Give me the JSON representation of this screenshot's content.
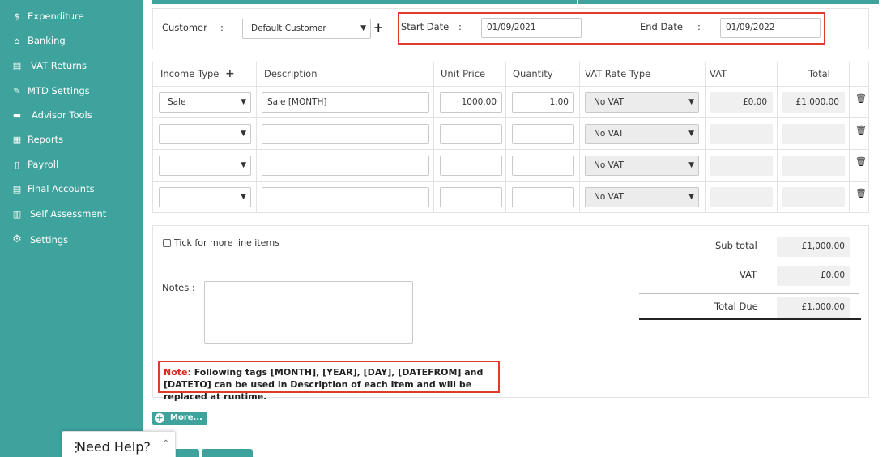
{
  "sidebar": {
    "items": [
      {
        "label": "Expenditure",
        "icon": "money-bag-icon",
        "glyph": "$"
      },
      {
        "label": "Banking",
        "icon": "bank-icon",
        "glyph": "⌂"
      },
      {
        "label": "VAT Returns",
        "icon": "vat-icon",
        "glyph": "▤"
      },
      {
        "label": "MTD Settings",
        "icon": "wrench-icon",
        "glyph": "✎"
      },
      {
        "label": "Advisor Tools",
        "icon": "briefcase-icon",
        "glyph": "▬"
      },
      {
        "label": "Reports",
        "icon": "reports-icon",
        "glyph": "▦"
      },
      {
        "label": "Payroll",
        "icon": "payroll-icon",
        "glyph": "▯"
      },
      {
        "label": "Final Accounts",
        "icon": "final-accounts-icon",
        "glyph": "▤"
      },
      {
        "label": "Self Assessment",
        "icon": "self-assessment-icon",
        "glyph": "▥"
      },
      {
        "label": "Settings",
        "icon": "gear-icon",
        "glyph": "⚙"
      }
    ]
  },
  "header_form": {
    "customer_label": "Customer",
    "colon": ":",
    "customer_value": "Default Customer",
    "start_date_label": "Start Date",
    "start_date_value": "01/09/2021",
    "end_date_label": "End Date",
    "end_date_value": "01/09/2022"
  },
  "table": {
    "columns": [
      "Income Type",
      "Description",
      "Unit Price",
      "Quantity",
      "VAT Rate Type",
      "VAT",
      "Total"
    ],
    "rows": [
      {
        "income_type": "Sale",
        "description": "Sale [MONTH]",
        "unit_price": "1000.00",
        "quantity": "1.00",
        "vat_rate_type": "No VAT",
        "vat": "£0.00",
        "total": "£1,000.00"
      },
      {
        "income_type": "",
        "description": "",
        "unit_price": "",
        "quantity": "",
        "vat_rate_type": "No VAT",
        "vat": "",
        "total": ""
      },
      {
        "income_type": "",
        "description": "",
        "unit_price": "",
        "quantity": "",
        "vat_rate_type": "No VAT",
        "vat": "",
        "total": ""
      },
      {
        "income_type": "",
        "description": "",
        "unit_price": "",
        "quantity": "",
        "vat_rate_type": "No VAT",
        "vat": "",
        "total": ""
      }
    ]
  },
  "summary": {
    "tick_label": "Tick for more line items",
    "notes_label": "Notes :",
    "subtotal_label": "Sub total",
    "subtotal_value": "£1,000.00",
    "vat_label": "VAT",
    "vat_value": "£0.00",
    "total_due_label": "Total Due",
    "total_due_value": "£1,000.00"
  },
  "note": {
    "prefix": "Note:",
    "text": "Following tags [MONTH], [YEAR], [DAY], [DATEFROM] and [DATETO] can be used in Description of each Item and will be replaced at runtime."
  },
  "more_button": "More...",
  "help_widget": {
    "label": "Need Help?"
  },
  "colors": {
    "accent": "#3fa39d",
    "highlight": "#e03a2a"
  }
}
